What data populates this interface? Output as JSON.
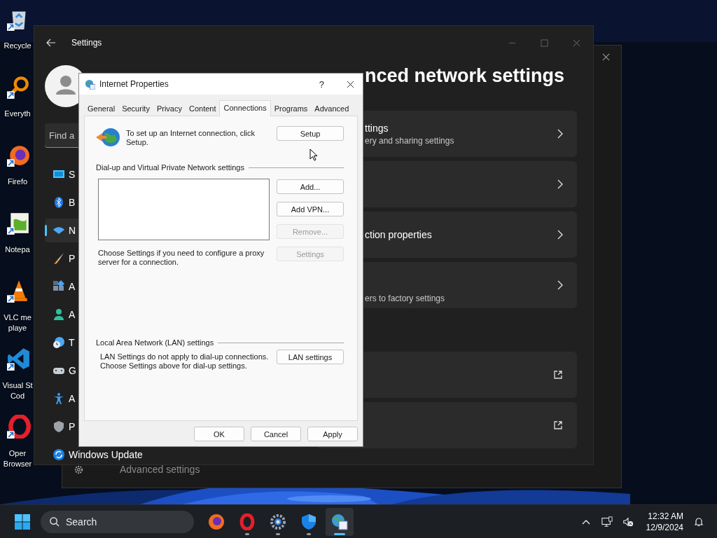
{
  "desktop": {
    "icons": [
      {
        "kind": "recycle",
        "lines": [
          "Recycle"
        ]
      },
      {
        "kind": "magnifier",
        "lines": [
          "Everyth"
        ]
      },
      {
        "kind": "firefox",
        "lines": [
          "Firefo"
        ]
      },
      {
        "kind": "notepad",
        "lines": [
          "Notepa"
        ]
      },
      {
        "kind": "vlc",
        "lines": [
          "VLC me",
          "playe"
        ]
      },
      {
        "kind": "vscode",
        "lines": [
          "Visual St",
          "Cod"
        ]
      },
      {
        "kind": "opera",
        "lines": [
          "Oper",
          "Browser"
        ]
      }
    ]
  },
  "back_window": {
    "item": "Advanced settings"
  },
  "settings": {
    "title": "Settings",
    "search_placeholder": "Find a",
    "nav": [
      {
        "kind": "system",
        "label": "S",
        "selected": false
      },
      {
        "kind": "bluetooth",
        "label": "B",
        "selected": false
      },
      {
        "kind": "network",
        "label": "N",
        "selected": true
      },
      {
        "kind": "brush",
        "label": "P",
        "selected": false
      },
      {
        "kind": "apps",
        "label": "A",
        "selected": false
      },
      {
        "kind": "person",
        "label": "A",
        "selected": false
      },
      {
        "kind": "clock",
        "label": "T",
        "selected": false
      },
      {
        "kind": "gamepad",
        "label": "G",
        "selected": false
      },
      {
        "kind": "accessibility",
        "label": "A",
        "selected": false
      },
      {
        "kind": "shield",
        "label": "P",
        "selected": false
      },
      {
        "kind": "update",
        "label": "Windows Update",
        "selected": false
      }
    ],
    "heading": "nced network settings",
    "cards": [
      {
        "kind": "chevron",
        "title": "ttings",
        "subtitle": "ery and sharing settings"
      },
      {
        "kind": "chevron"
      },
      {
        "kind": "chevron",
        "title": "ction properties"
      },
      {
        "kind": "chevron",
        "subtitle": "ers to factory settings"
      },
      {
        "kind": "external"
      },
      {
        "kind": "external"
      }
    ]
  },
  "dialog": {
    "title": "Internet Properties",
    "help": "?",
    "tabs": [
      {
        "label": "General",
        "selected": false
      },
      {
        "label": "Security",
        "selected": false
      },
      {
        "label": "Privacy",
        "selected": false
      },
      {
        "label": "Content",
        "selected": false
      },
      {
        "label": "Connections",
        "selected": true
      },
      {
        "label": "Programs",
        "selected": false
      },
      {
        "label": "Advanced",
        "selected": false
      }
    ],
    "setup_text": "To set up an Internet connection, click Setup.",
    "setup_button": "Setup",
    "vpn_group": "Dial-up and Virtual Private Network settings",
    "vpn_buttons": [
      {
        "label": "Add...",
        "disabled": false
      },
      {
        "label": "Add VPN...",
        "disabled": false
      },
      {
        "label": "Remove...",
        "disabled": true
      },
      {
        "label": "Settings",
        "disabled": true
      }
    ],
    "proxy_text": "Choose Settings if you need to configure a proxy server for a connection.",
    "lan_group": "Local Area Network (LAN) settings",
    "lan_text": "LAN Settings do not apply to dial-up connections. Choose Settings above for dial-up settings.",
    "lan_button": "LAN settings",
    "buttons": [
      "OK",
      "Cancel",
      "Apply"
    ]
  },
  "taskbar": {
    "search": "Search",
    "apps": [
      {
        "kind": "firefox",
        "running": false,
        "active": false
      },
      {
        "kind": "opera",
        "running": true,
        "active": false
      },
      {
        "kind": "gear",
        "running": true,
        "active": false
      },
      {
        "kind": "shield",
        "running": true,
        "active": false
      },
      {
        "kind": "globe",
        "running": true,
        "active": true
      }
    ],
    "time": "12:32 AM",
    "date": "12/9/2024"
  }
}
